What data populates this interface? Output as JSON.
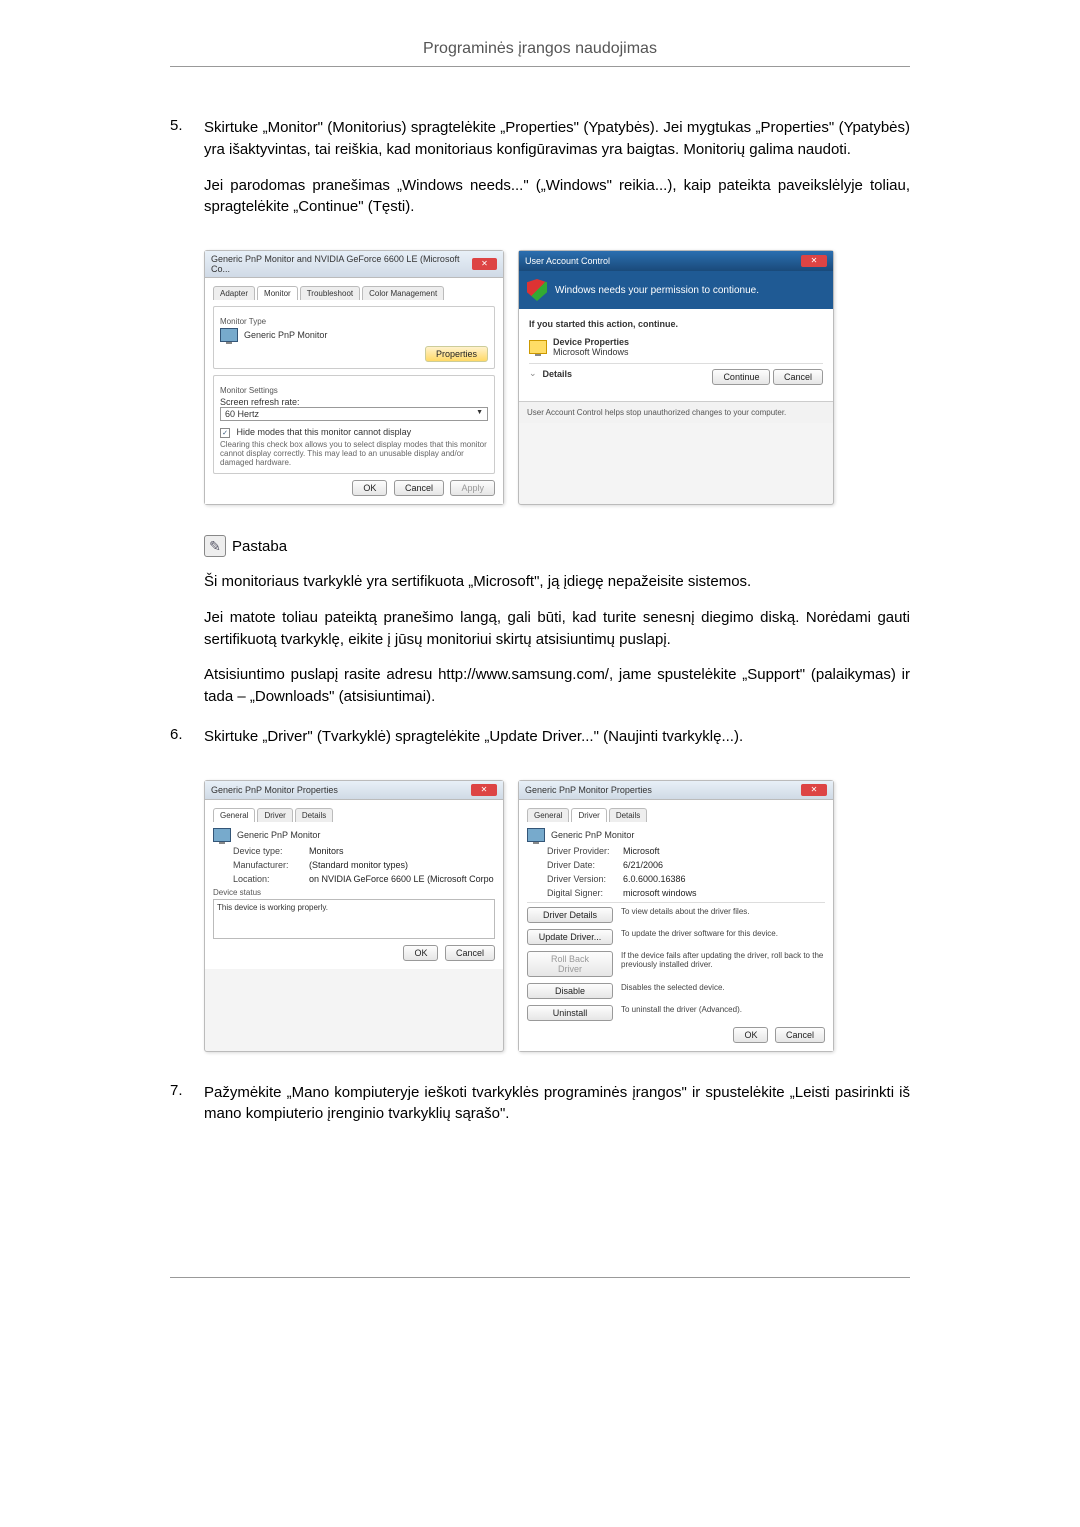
{
  "header": {
    "title": "Programinės įrangos naudojimas"
  },
  "steps": {
    "s5": {
      "num": "5.",
      "p1": "Skirtuke „Monitor\" (Monitorius) spragtelėkite „Properties\" (Ypatybės). Jei mygtukas „Properties\" (Ypatybės) yra išaktyvintas, tai reiškia, kad monitoriaus konfigūravimas yra baigtas. Monitorių galima naudoti.",
      "p2": "Jei parodomas pranešimas „Windows needs...\" („Windows\" reikia...), kaip pateikta paveikslėlyje toliau, spragtelėkite „Continue\" (Tęsti)."
    },
    "s6": {
      "num": "6.",
      "p1": "Skirtuke „Driver\" (Tvarkyklė) spragtelėkite „Update Driver...\" (Naujinti tvarkyklę...)."
    },
    "s7": {
      "num": "7.",
      "p1": "Pažymėkite „Mano kompiuteryje ieškoti tvarkyklės programinės įrangos\" ir spustelėkite „Leisti pasirinkti iš mano kompiuterio įrenginio tvarkyklių sąrašo\"."
    }
  },
  "note": {
    "label": "Pastaba",
    "p1": "Ši monitoriaus tvarkyklė yra sertifikuota „Microsoft\", ją įdiegę nepažeisite sistemos.",
    "p2": "Jei matote toliau pateiktą pranešimo langą, gali būti, kad turite senesnį diegimo diską. Norėdami gauti sertifikuotą tvarkyklę, eikite į jūsų monitoriui skirtų atsisiuntimų puslapį.",
    "p3": "Atsisiuntimo puslapį rasite adresu http://www.samsung.com/, jame spustelėkite „Support\" (palaikymas) ir tada – „Downloads\" (atsisiuntimai)."
  },
  "monitorDlg": {
    "title": "Generic PnP Monitor and NVIDIA GeForce 6600 LE (Microsoft Co...",
    "tabs": {
      "adapter": "Adapter",
      "monitor": "Monitor",
      "trouble": "Troubleshoot",
      "color": "Color Management"
    },
    "monitorType": "Monitor Type",
    "monitorName": "Generic PnP Monitor",
    "propertiesBtn": "Properties",
    "settings": "Monitor Settings",
    "refresh": "Screen refresh rate:",
    "hz": "60 Hertz",
    "hideCheck": "Hide modes that this monitor cannot display",
    "hideDesc": "Clearing this check box allows you to select display modes that this monitor cannot display correctly. This may lead to an unusable display and/or damaged hardware.",
    "ok": "OK",
    "cancel": "Cancel",
    "apply": "Apply"
  },
  "uac": {
    "title": "User Account Control",
    "banner": "Windows needs your permission to contionue.",
    "ifStarted": "If you started this action, continue.",
    "devProp": "Device Properties",
    "msWin": "Microsoft Windows",
    "details": "Details",
    "continue": "Continue",
    "cancel": "Cancel",
    "footer": "User Account Control helps stop unauthorized changes to your computer."
  },
  "propGeneral": {
    "title": "Generic PnP Monitor Properties",
    "tabs": {
      "general": "General",
      "driver": "Driver",
      "details": "Details"
    },
    "name": "Generic PnP Monitor",
    "devType": "Device type:",
    "devTypeV": "Monitors",
    "manu": "Manufacturer:",
    "manuV": "(Standard monitor types)",
    "loc": "Location:",
    "locV": "on NVIDIA GeForce 6600 LE (Microsoft Corpo",
    "status": "Device status",
    "statusText": "This device is working properly.",
    "ok": "OK",
    "cancel": "Cancel"
  },
  "propDriver": {
    "title": "Generic PnP Monitor Properties",
    "name": "Generic PnP Monitor",
    "prov": "Driver Provider:",
    "provV": "Microsoft",
    "date": "Driver Date:",
    "dateV": "6/21/2006",
    "ver": "Driver Version:",
    "verV": "6.0.6000.16386",
    "sign": "Digital Signer:",
    "signV": "microsoft windows",
    "btnDetails": "Driver Details",
    "descDetails": "To view details about the driver files.",
    "btnUpdate": "Update Driver...",
    "descUpdate": "To update the driver software for this device.",
    "btnRoll": "Roll Back Driver",
    "descRoll": "If the device fails after updating the driver, roll back to the previously installed driver.",
    "btnDisable": "Disable",
    "descDisable": "Disables the selected device.",
    "btnUninstall": "Uninstall",
    "descUninstall": "To uninstall the driver (Advanced).",
    "ok": "OK",
    "cancel": "Cancel"
  }
}
